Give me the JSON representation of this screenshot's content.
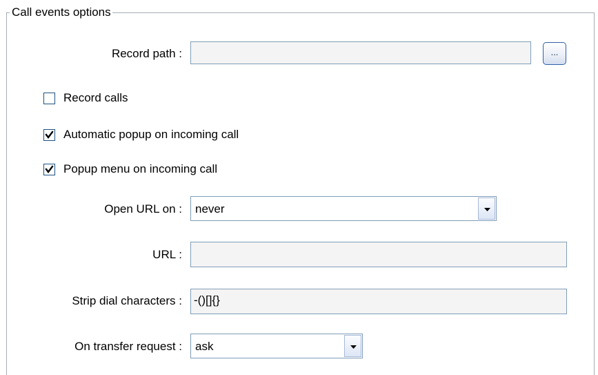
{
  "group": {
    "title": "Call events options"
  },
  "record_path": {
    "label": "Record path :",
    "value": "",
    "browse_label": "..."
  },
  "checkboxes": [
    {
      "label": "Record calls",
      "checked": false
    },
    {
      "label": "Automatic popup on incoming call",
      "checked": true
    },
    {
      "label": "Popup menu on incoming call",
      "checked": true
    }
  ],
  "open_url": {
    "label": "Open URL on :",
    "selected": "never"
  },
  "url": {
    "label": "URL :",
    "value": ""
  },
  "strip_dial": {
    "label": "Strip dial characters :",
    "value": "-()[]{}"
  },
  "transfer": {
    "label": "On transfer request :",
    "selected": "ask"
  },
  "icons": {
    "checkmark": "checkmark-icon",
    "dropdown": "chevron-down-icon"
  }
}
